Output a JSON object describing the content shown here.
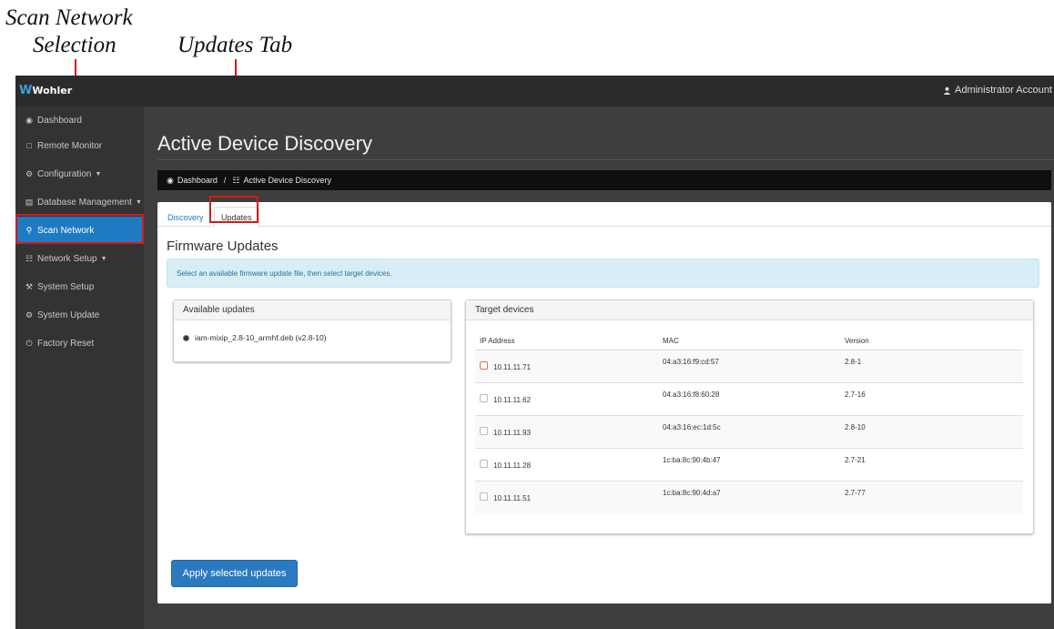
{
  "callouts": {
    "scan_network_line1": "Scan Network",
    "scan_network_line2": "Selection",
    "updates_tab": "Updates Tab"
  },
  "topbar": {
    "brand": "Wohler",
    "account": "Administrator Account"
  },
  "sidebar": {
    "items": [
      {
        "label": "Dashboard",
        "icon": "dashboard-icon"
      },
      {
        "label": "Remote Monitor",
        "icon": "monitor-icon"
      },
      {
        "label": "Configuration",
        "icon": "gears-icon"
      },
      {
        "label": "Database Management",
        "icon": "database-icon"
      },
      {
        "label": "Scan Network",
        "icon": "search-icon"
      },
      {
        "label": "Network Setup",
        "icon": "sitemap-icon"
      },
      {
        "label": "System Setup",
        "icon": "wrench-icon"
      },
      {
        "label": "System Update",
        "icon": "gear-icon"
      },
      {
        "label": "Factory Reset",
        "icon": "power-icon"
      }
    ]
  },
  "main": {
    "title": "Active Device Discovery",
    "breadcrumb": {
      "home": "Dashboard",
      "separator": "/",
      "current": "Active Device Discovery"
    },
    "tabs": [
      {
        "label": "Discovery"
      },
      {
        "label": "Updates"
      }
    ],
    "section_title": "Firmware Updates",
    "info": "Select an available firmware update file, then select target devices.",
    "available": {
      "heading": "Available updates",
      "file": "iam-mixip_2.8-10_armhf.deb (v2.8-10)"
    },
    "targets": {
      "heading": "Target devices",
      "columns": [
        "IP Address",
        "MAC",
        "Version"
      ],
      "rows": [
        {
          "ip": "10.11.11.71",
          "mac": "04:a3:16:f9:cd:57",
          "version": "2.8-1"
        },
        {
          "ip": "10.11.11.62",
          "mac": "04:a3:16:f8:60:28",
          "version": "2.7-16"
        },
        {
          "ip": "10.11.11.93",
          "mac": "04:a3:16:ec:1d:5c",
          "version": "2.8-10"
        },
        {
          "ip": "10.11.11.28",
          "mac": "1c:ba:8c:90:4b:47",
          "version": "2.7-21"
        },
        {
          "ip": "10.11.11.51",
          "mac": "1c:ba:8c:90:4d:a7",
          "version": "2.7-77"
        }
      ]
    },
    "apply_label": "Apply selected updates"
  },
  "colors": {
    "accent": "#1f7bc1",
    "callout": "#d41a1a",
    "sidebar": "#333333",
    "topbar": "#2b2b2b"
  }
}
